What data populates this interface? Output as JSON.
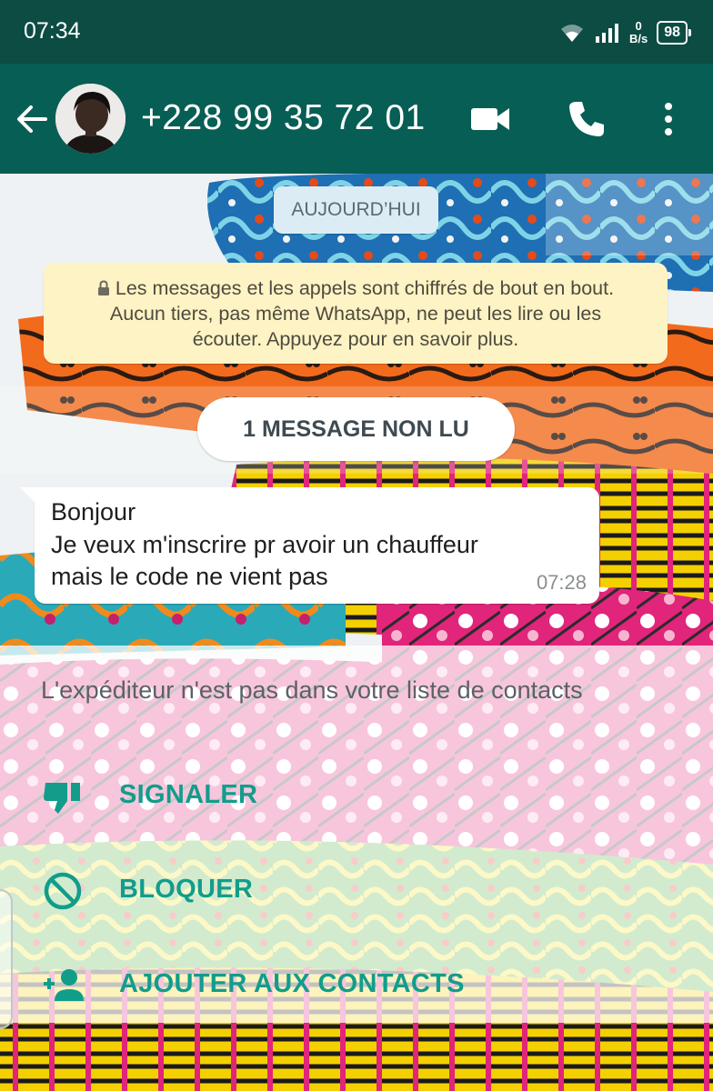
{
  "status_bar": {
    "time": "07:34",
    "net_speed_value": "0",
    "net_speed_unit": "B/s",
    "battery": "98",
    "icons": [
      "wifi-icon",
      "signal-icon",
      "battery-icon"
    ]
  },
  "app_bar": {
    "contact": "+228 99 35 72 01",
    "icons": [
      "back-arrow-icon",
      "avatar",
      "video-call-icon",
      "phone-icon",
      "more-vert-icon"
    ],
    "background": "#075e54"
  },
  "chat": {
    "date_label": "AUJOURD’HUI",
    "encryption_notice": [
      "Les messages et les appels sont chiffrés de bout en bout.",
      "Aucun tiers, pas même WhatsApp, ne peut les lire ou les",
      "écouter. Appuyez pour en savoir plus."
    ],
    "unread_label": "1 MESSAGE NON LU",
    "message": {
      "lines": [
        "Bonjour",
        "Je veux m'inscrire pr avoir un chauffeur",
        "mais le code ne vient pas"
      ],
      "time": "07:28"
    }
  },
  "spam_panel": {
    "note": "L'expéditeur n'est pas dans votre liste de contacts",
    "actions": [
      {
        "label": "SIGNALER",
        "icon": "thumb-down-icon"
      },
      {
        "label": "BLOQUER",
        "icon": "block-icon"
      },
      {
        "label": "AJOUTER AUX CONTACTS",
        "icon": "add-person-icon"
      }
    ],
    "accent": "#129d8b"
  }
}
